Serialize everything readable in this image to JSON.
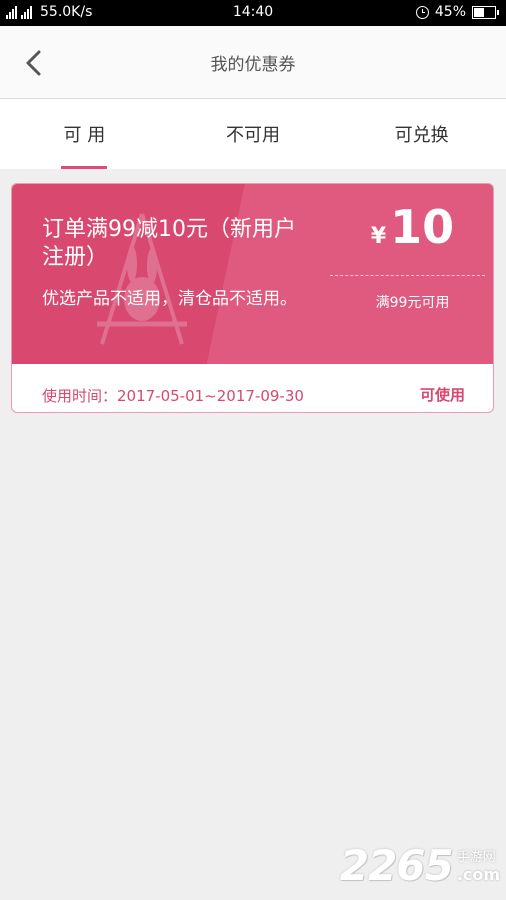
{
  "status_bar": {
    "network_label": "2G 4G4G",
    "speed": "55.0K/s",
    "time": "14:40",
    "battery": "45%",
    "battery_level": 0.45
  },
  "header": {
    "back_icon": "chevron-left-icon",
    "title": "我的优惠券"
  },
  "tabs": [
    {
      "label": "可 用",
      "active": true
    },
    {
      "label": "不可用",
      "active": false
    },
    {
      "label": "可兑换",
      "active": false
    }
  ],
  "coupon": {
    "title": "订单满99减10元（新用户注册）",
    "description": "优选产品不适用，清仓品不适用。",
    "currency": "¥",
    "amount": "10",
    "condition": "满99元可用",
    "period": "使用时间：2017-05-01~2017-09-30",
    "status": "可使用"
  },
  "watermark": {
    "number": "2265",
    "cn": "手游网",
    "com": ".com"
  },
  "colors": {
    "accent": "#d8486f",
    "tab_indicator": "#e04b7b",
    "background": "#efefef"
  }
}
